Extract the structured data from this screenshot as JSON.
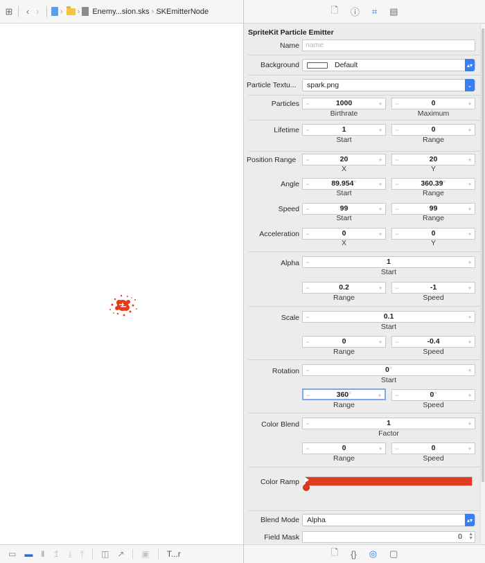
{
  "jumpbar": {
    "grid_icon": "grid-icon",
    "back_icon": "chevron-left-icon",
    "forward_icon": "chevron-right-icon",
    "file_label": "Enemy...sion.sks",
    "node_label": "SKEmitterNode"
  },
  "inspector_tabs": [
    "file-icon",
    "help-icon",
    "attributes-icon",
    "size-icon"
  ],
  "emitter": {
    "section_title": "SpriteKit Particle Emitter",
    "name": {
      "label": "Name",
      "placeholder": "name"
    },
    "background": {
      "label": "Background",
      "value": "Default"
    },
    "texture": {
      "label": "Particle Textu...",
      "value": "spark.png"
    },
    "particles": {
      "label": "Particles",
      "birthrate": "1000",
      "birthrate_label": "Birthrate",
      "maximum": "0",
      "maximum_label": "Maximum"
    },
    "lifetime": {
      "label": "Lifetime",
      "start": "1",
      "start_label": "Start",
      "range": "0",
      "range_label": "Range"
    },
    "position_range": {
      "label": "Position Range",
      "x": "20",
      "x_label": "X",
      "y": "20",
      "y_label": "Y"
    },
    "angle": {
      "label": "Angle",
      "start": "89.954",
      "start_label": "Start",
      "range": "360.39",
      "range_label": "Range",
      "unit": "°"
    },
    "speed": {
      "label": "Speed",
      "start": "99",
      "start_label": "Start",
      "range": "99",
      "range_label": "Range"
    },
    "acceleration": {
      "label": "Acceleration",
      "x": "0",
      "x_label": "X",
      "y": "0",
      "y_label": "Y"
    },
    "alpha": {
      "label": "Alpha",
      "start": "1",
      "start_label": "Start",
      "range": "0.2",
      "range_label": "Range",
      "speed": "-1",
      "speed_label": "Speed"
    },
    "scale": {
      "label": "Scale",
      "start": "0.1",
      "start_label": "Start",
      "range": "0",
      "range_label": "Range",
      "speed": "-0.4",
      "speed_label": "Speed"
    },
    "rotation": {
      "label": "Rotation",
      "start": "0",
      "start_label": "Start",
      "range": "360",
      "range_label": "Range",
      "speed": "0",
      "speed_label": "Speed",
      "unit": "°"
    },
    "color_blend": {
      "label": "Color Blend",
      "factor": "1",
      "factor_label": "Factor",
      "range": "0",
      "range_label": "Range",
      "speed": "0",
      "speed_label": "Speed"
    },
    "color_ramp": {
      "label": "Color Ramp",
      "color": "#e03a20"
    },
    "blend_mode": {
      "label": "Blend Mode",
      "value": "Alpha"
    },
    "field_mask": {
      "label": "Field Mask",
      "value": "0"
    }
  },
  "bottom_left": {
    "truncated_label": "T...r",
    "accent": "#2d6fd9"
  },
  "bottom_right_tabs": [
    "file-icon",
    "braces-icon",
    "target-icon",
    "media-icon"
  ]
}
